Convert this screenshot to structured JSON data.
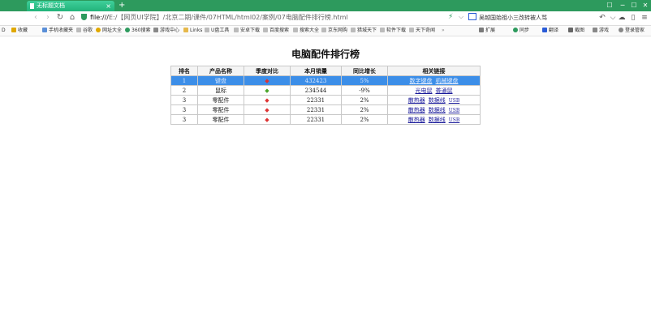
{
  "browser": {
    "tab_title": "无标题文档",
    "tab_close": "×",
    "new_tab": "+",
    "address_scheme": "file:///",
    "address_rest": "E:/【网页UI学院】/北京二期/课件/07HTML/html02/案例/07电脑配件排行榜.html",
    "search_text": "吴越国始祖小三改转被人骂",
    "window_controls": [
      "☐",
      "─",
      "☐",
      "✕"
    ]
  },
  "bookmarks": [
    {
      "label": "收藏",
      "color": "#e0a800"
    },
    {
      "label": "手机收藏夹",
      "color": "#5a8fd8"
    },
    {
      "label": "谷歌",
      "color": "#999999"
    },
    {
      "label": "网址大全",
      "color": "#e0a800"
    },
    {
      "label": "360搜索",
      "color": "#2d9a5d"
    },
    {
      "label": "游戏中心",
      "color": "#888888"
    },
    {
      "label": "Links",
      "color": "#e6b84a"
    },
    {
      "label": "U盘工具",
      "color": "#999999"
    },
    {
      "label": "安卓下载",
      "color": "#999999"
    },
    {
      "label": "百度搜索",
      "color": "#999999"
    },
    {
      "label": "搜索大全",
      "color": "#999999"
    },
    {
      "label": "京东网购",
      "color": "#999999"
    },
    {
      "label": "猎城天下",
      "color": "#999999"
    },
    {
      "label": "软件下载",
      "color": "#999999"
    },
    {
      "label": "天下奇闻",
      "color": "#999999"
    }
  ],
  "bookmarks_right": [
    "扩展",
    "同步",
    "翻译",
    "截图",
    "游戏",
    "登录管家"
  ],
  "page": {
    "title": "电脑配件排行榜",
    "headers": [
      "排名",
      "产品名称",
      "季度对比",
      "本月销量",
      "同比增长",
      "相关链接"
    ],
    "rows": [
      {
        "rank": "1",
        "name": "键盘",
        "mark": "◆",
        "sales": "432423",
        "growth": "5%",
        "links": [
          "数字键盘",
          "机械键盘"
        ],
        "small_link": "",
        "selected": true
      },
      {
        "rank": "2",
        "name": "鼠标",
        "mark": "◆",
        "sales": "234544",
        "growth": "-9%",
        "links": [
          "光电鼠",
          "普通鼠"
        ],
        "small_link": "",
        "selected": false
      },
      {
        "rank": "3",
        "name": "零配件",
        "mark": "◆",
        "sales": "22331",
        "growth": "2%",
        "links": [
          "散热器",
          "数据线"
        ],
        "small_link": "USB",
        "selected": false
      },
      {
        "rank": "3",
        "name": "零配件",
        "mark": "◆",
        "sales": "22331",
        "growth": "2%",
        "links": [
          "散热器",
          "数据线"
        ],
        "small_link": "USB",
        "selected": false
      },
      {
        "rank": "3",
        "name": "零配件",
        "mark": "◆",
        "sales": "22331",
        "growth": "2%",
        "links": [
          "散热器",
          "数据线"
        ],
        "small_link": "USB",
        "selected": false
      }
    ]
  }
}
